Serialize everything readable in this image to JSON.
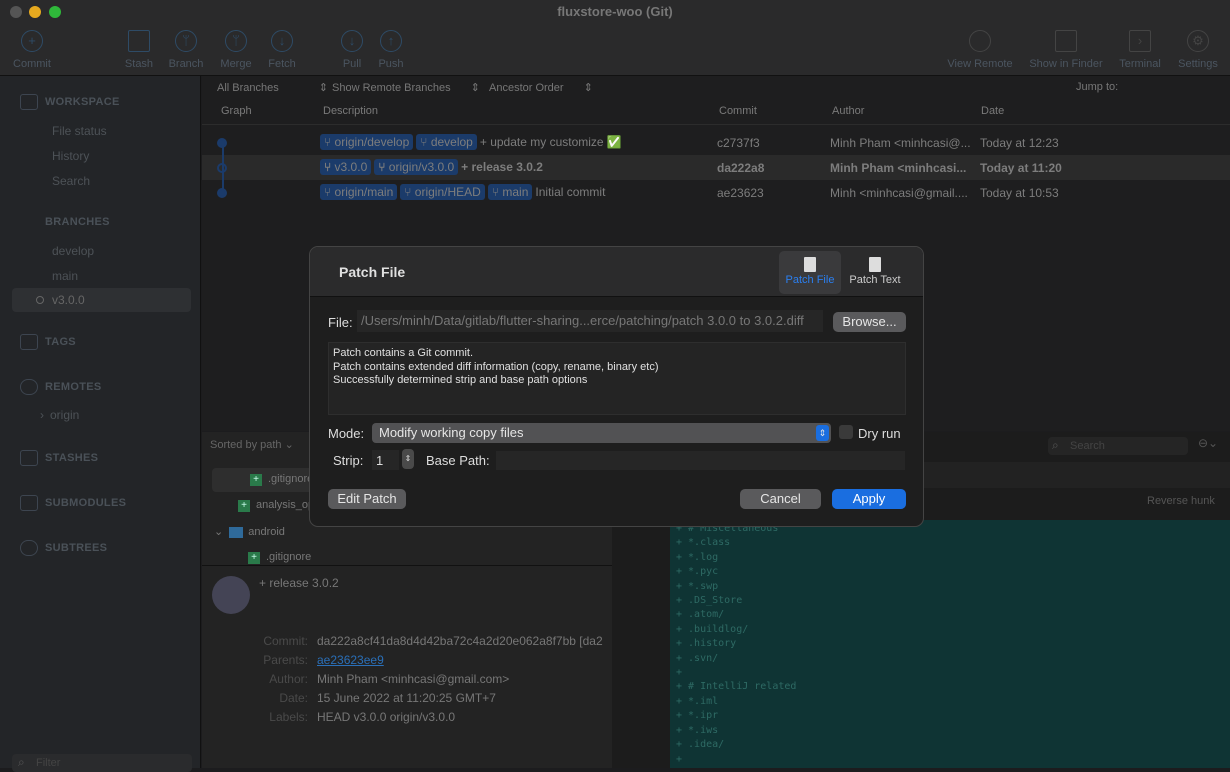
{
  "window": {
    "title": "fluxstore-woo (Git)"
  },
  "toolbar": {
    "commit": "Commit",
    "stash": "Stash",
    "branch": "Branch",
    "merge": "Merge",
    "fetch": "Fetch",
    "pull": "Pull",
    "push": "Push",
    "view_remote": "View Remote",
    "show_in_finder": "Show in Finder",
    "terminal": "Terminal",
    "settings": "Settings"
  },
  "sidebar": {
    "workspace": "WORKSPACE",
    "file_status": "File status",
    "history": "History",
    "search": "Search",
    "branches": "BRANCHES",
    "develop": "develop",
    "main": "main",
    "v300": "v3.0.0",
    "tags": "TAGS",
    "remotes": "REMOTES",
    "origin": "origin",
    "stashes": "STASHES",
    "submodules": "SUBMODULES",
    "subtrees": "SUBTREES",
    "filter_placeholder": "Filter"
  },
  "filters": {
    "branches": "All Branches",
    "remote": "Show Remote Branches",
    "order": "Ancestor Order",
    "jump": "Jump to:"
  },
  "columns": {
    "graph": "Graph",
    "description": "Description",
    "commit": "Commit",
    "author": "Author",
    "date": "Date"
  },
  "commits": [
    {
      "tags": [
        "origin/develop",
        "develop"
      ],
      "message": "+ update my customize ✅",
      "hash": "c2737f3",
      "author": "Minh Pham <minhcasi@...",
      "date": "Today at 12:23"
    },
    {
      "tags": [
        "v3.0.0",
        "origin/v3.0.0"
      ],
      "message": "+ release 3.0.2",
      "hash": "da222a8",
      "author": "Minh Pham <minhcasi...",
      "date": "Today at 11:20"
    },
    {
      "tags": [
        "origin/main",
        "origin/HEAD",
        "main"
      ],
      "message": "Initial commit",
      "hash": "ae23623",
      "author": "Minh <minhcasi@gmail....",
      "date": "Today at 10:53"
    }
  ],
  "files": {
    "sort": "Sorted by path",
    "items": [
      ".gitignore",
      "analysis_op",
      "android",
      ".gitignore"
    ]
  },
  "details": {
    "message": "+ release 3.0.2",
    "commit_label": "Commit:",
    "commit": "da222a8cf41da8d4d42ba72c4a2d20e062a8f7bb [da2",
    "parents_label": "Parents:",
    "parents": "ae23623ee9",
    "author_label": "Author:",
    "author": "Minh Pham <minhcasi@gmail.com>",
    "date_label": "Date:",
    "date": "15 June 2022 at 11:20:25 GMT+7",
    "labels_label": "Labels:",
    "labels": "HEAD v3.0.0 origin/v3.0.0"
  },
  "diff": {
    "search_placeholder": "Search",
    "reverse_hunk": "Reverse hunk",
    "lines": [
      "+ # Miscellaneous",
      "+ *.class",
      "+ *.log",
      "+ *.pyc",
      "+ *.swp",
      "+ .DS_Store",
      "+ .atom/",
      "+ .buildlog/",
      "+ .history",
      "+ .svn/",
      "+",
      "+ # IntelliJ related",
      "+ *.iml",
      "+ *.ipr",
      "+ *.iws",
      "+ .idea/",
      "+"
    ]
  },
  "dialog": {
    "title": "Patch File",
    "tab_file": "Patch File",
    "tab_text": "Patch Text",
    "file_label": "File:",
    "file_value": "/Users/minh/Data/gitlab/flutter-sharing...erce/patching/patch 3.0.0 to 3.0.2.diff",
    "browse": "Browse...",
    "info": [
      "Patch contains a Git commit.",
      "Patch contains extended diff information (copy, rename, binary etc)",
      "Successfully determined strip and base path options"
    ],
    "mode_label": "Mode:",
    "mode_value": "Modify working copy files",
    "dry_run": "Dry run",
    "dry_run_checked": false,
    "strip_label": "Strip:",
    "strip_value": "1",
    "base_path_label": "Base Path:",
    "base_path_value": "",
    "edit_patch": "Edit Patch",
    "cancel": "Cancel",
    "apply": "Apply"
  },
  "colors": {
    "accent": "#1a6ee0",
    "tag": "#1b3b6a",
    "diff_bg": "#0f3434"
  }
}
